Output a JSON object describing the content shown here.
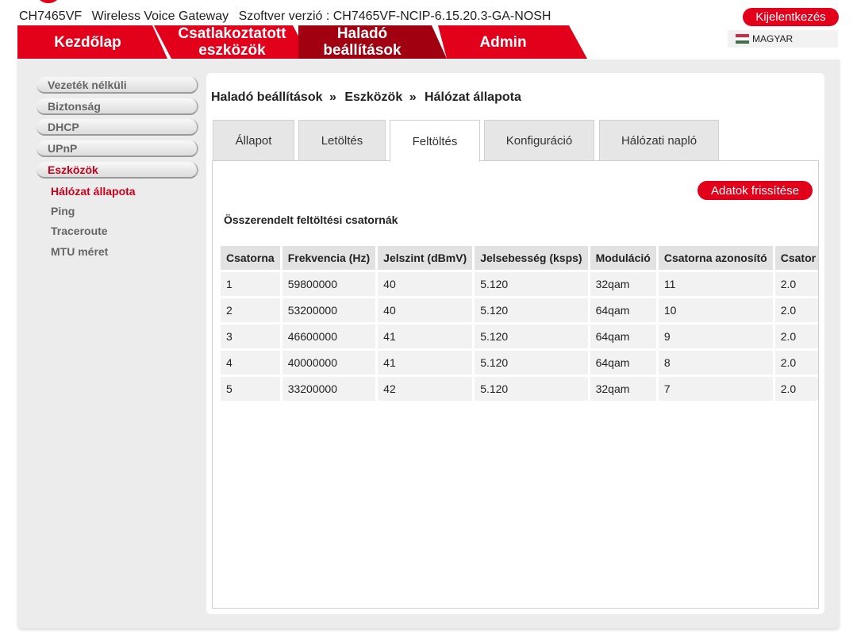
{
  "header": {
    "model": "CH7465VF",
    "product": "Wireless Voice Gateway",
    "firmware": "Szoftver verzió : CH7465VF-NCIP-6.15.20.3-GA-NOSH",
    "logout": "Kijelentkezés",
    "language": "MAGYAR"
  },
  "nav": {
    "home": "Kezdőlap",
    "devices_line1": "Csatlakoztatott",
    "devices_line2": "eszközök",
    "advanced_line1": "Haladó",
    "advanced_line2": "beállítások",
    "admin": "Admin"
  },
  "sidebar": {
    "items": [
      "Vezeték nélküli",
      "Biztonság",
      "DHCP",
      "UPnP",
      "Eszközök"
    ],
    "sub": [
      "Hálózat állapota",
      "Ping",
      "Traceroute",
      "MTU méret"
    ]
  },
  "breadcrumb": {
    "part1": "Haladó beállítások",
    "sep": "»",
    "part2": "Eszközök",
    "part3": "Hálózat állapota"
  },
  "tabs": [
    "Állapot",
    "Letöltés",
    "Feltöltés",
    "Konfiguráció",
    "Hálózati napló"
  ],
  "panel": {
    "refresh": "Adatok frissítése",
    "section_title": "Összerendelt feltöltési csatornák",
    "columns": [
      "Csatorna",
      "Frekvencia (Hz)",
      "Jelszint (dBmV)",
      "Jelsebesség (ksps)",
      "Moduláció",
      "Csatorna azonosító",
      "Csator"
    ],
    "rows": [
      [
        "1",
        "59800000",
        "40",
        "5.120",
        "32qam",
        "11",
        "2.0"
      ],
      [
        "2",
        "53200000",
        "40",
        "5.120",
        "64qam",
        "10",
        "2.0"
      ],
      [
        "3",
        "46600000",
        "41",
        "5.120",
        "64qam",
        "9",
        "2.0"
      ],
      [
        "4",
        "40000000",
        "41",
        "5.120",
        "64qam",
        "8",
        "2.0"
      ],
      [
        "5",
        "33200000",
        "42",
        "5.120",
        "32qam",
        "7",
        "2.0"
      ]
    ]
  },
  "colors": {
    "brand_red": "#e2001a",
    "active_tab": "#a0000f",
    "sidebar_active": "#c8001a"
  }
}
